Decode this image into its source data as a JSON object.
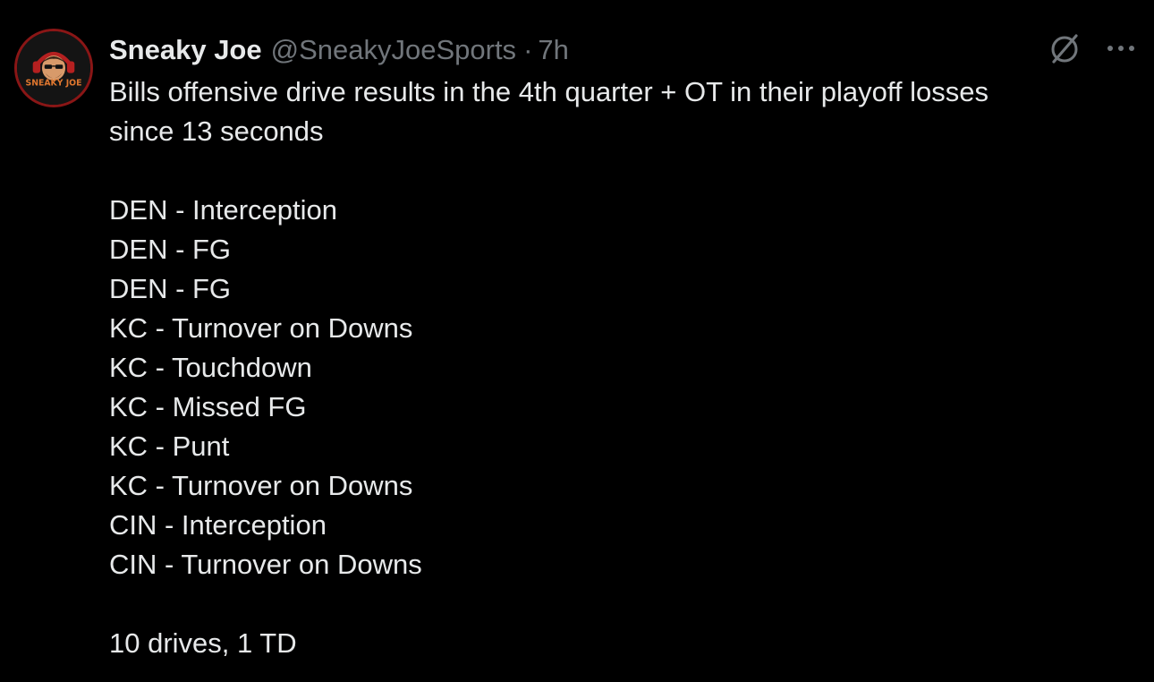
{
  "tweet": {
    "author": {
      "display_name": "Sneaky Joe",
      "handle": "@SneakyJoeSports",
      "avatar_text": "SNEAKY JOE"
    },
    "separator": "·",
    "timestamp": "7h",
    "icons": {
      "grok": "grok-slash-icon",
      "more": "more-dots-icon"
    },
    "text": {
      "intro_line_1": "Bills offensive drive results in the 4th quarter + OT in their playoff losses",
      "intro_line_2": "since 13 seconds",
      "drives": [
        "DEN - Interception",
        "DEN - FG",
        "DEN - FG",
        "KC - Turnover on Downs",
        "KC - Touchdown",
        "KC - Missed FG",
        "KC - Punt",
        "KC - Turnover on Downs",
        "CIN - Interception",
        "CIN - Turnover on Downs"
      ],
      "summary": "10 drives, 1 TD"
    },
    "colors": {
      "background": "#000000",
      "text_primary": "#e7e9ea",
      "text_secondary": "#71767b",
      "avatar_ring": "#8a1616",
      "avatar_accent": "#c0392b"
    }
  }
}
